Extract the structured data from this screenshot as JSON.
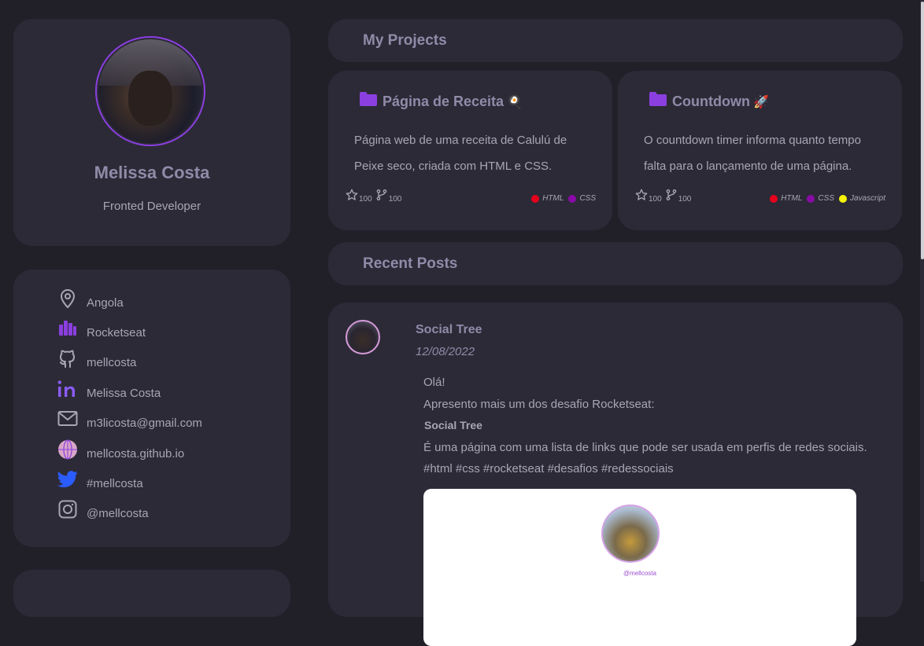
{
  "profile": {
    "name": "Melissa Costa",
    "role": "Fronted Developer"
  },
  "contacts": [
    {
      "icon": "location-pin-icon",
      "label": "Angola"
    },
    {
      "icon": "rocketseat-icon",
      "label": "Rocketseat"
    },
    {
      "icon": "github-icon",
      "label": "mellcosta"
    },
    {
      "icon": "linkedin-icon",
      "label": "Melissa Costa"
    },
    {
      "icon": "mail-icon",
      "label": "m3licosta@gmail.com"
    },
    {
      "icon": "globe-icon",
      "label": "mellcosta.github.io"
    },
    {
      "icon": "twitter-icon",
      "label": "#mellcosta"
    },
    {
      "icon": "instagram-icon",
      "label": "@mellcosta"
    }
  ],
  "projects_section": {
    "title": "My Projects"
  },
  "projects": [
    {
      "name": "Página de Receita",
      "emoji": "🍳",
      "description": "Página web de uma receita de Calulú de Peixe seco, criada com HTML e CSS.",
      "stars": "100",
      "forks": "100",
      "languages": [
        {
          "name": "HTML",
          "color": "#e5001c"
        },
        {
          "name": "CSS",
          "color": "#8a0aa8"
        }
      ]
    },
    {
      "name": "Countdown",
      "emoji": "🚀",
      "description": "O countdown timer informa quanto tempo falta para o lançamento de uma página.",
      "stars": "100",
      "forks": "100",
      "languages": [
        {
          "name": "HTML",
          "color": "#e5001c"
        },
        {
          "name": "CSS",
          "color": "#8a0aa8"
        },
        {
          "name": "Javascript",
          "color": "#f7f20a"
        }
      ]
    }
  ],
  "posts_section": {
    "title": "Recent Posts"
  },
  "post": {
    "title": "Social Tree",
    "date": "12/08/2022",
    "lines": [
      "Olá!",
      "Apresento mais um dos desafio Rocketseat:",
      "Social Tree",
      "É uma página com uma lista de links que pode ser usada em perfis de redes sociais.",
      "#html #css #rocketseat #desafios #redessociais"
    ],
    "preview_handle": "@mellcosta"
  },
  "colors": {
    "background": "#212029",
    "card": "#2c2a37",
    "accent": "#8b3fe0",
    "title_text": "#8f8ba8",
    "body_text": "#a8a6b5"
  }
}
